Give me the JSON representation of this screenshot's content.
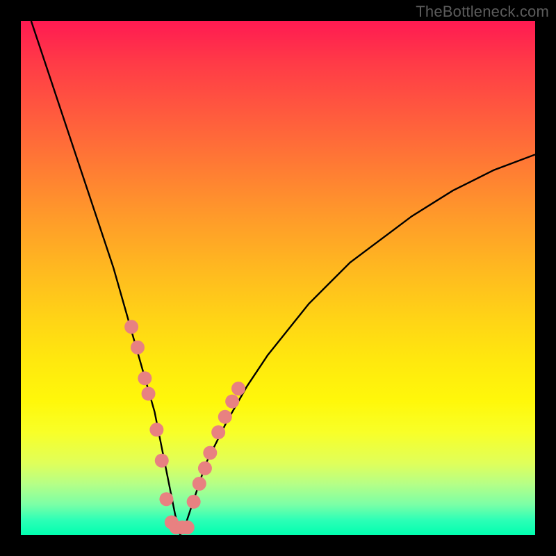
{
  "watermark": "TheBottleneck.com",
  "colors": {
    "frame": "#000000",
    "curve": "#000000",
    "dots": "#e88181",
    "dot_stroke": "#d76a6a"
  },
  "chart_data": {
    "type": "line",
    "title": "",
    "xlabel": "",
    "ylabel": "",
    "xlim": [
      0,
      100
    ],
    "ylim": [
      0,
      100
    ],
    "grid": false,
    "series": [
      {
        "name": "bottleneck-curve",
        "x": [
          2,
          4,
          6,
          8,
          10,
          12,
          14,
          16,
          18,
          20,
          22,
          24,
          26,
          28,
          30,
          31,
          32,
          34,
          36,
          40,
          44,
          48,
          52,
          56,
          60,
          64,
          68,
          72,
          76,
          80,
          84,
          88,
          92,
          96,
          100
        ],
        "y": [
          100,
          94,
          88,
          82,
          76,
          70,
          64,
          58,
          52,
          45,
          38,
          31,
          24,
          14,
          4,
          0,
          2,
          8,
          14,
          22,
          29,
          35,
          40,
          45,
          49,
          53,
          56,
          59,
          62,
          64.5,
          67,
          69,
          71,
          72.5,
          74
        ]
      }
    ],
    "highlight_points": {
      "name": "salmon-dots",
      "x": [
        21.5,
        22.7,
        24.1,
        24.8,
        26.4,
        27.4,
        28.3,
        29.3,
        30.2,
        31.4,
        32.4,
        33.6,
        34.7,
        35.8,
        36.8,
        38.4,
        39.7,
        41.1,
        42.3
      ],
      "y": [
        40.5,
        36.5,
        30.5,
        27.5,
        20.5,
        14.5,
        7.0,
        2.5,
        1.5,
        1.5,
        1.5,
        6.5,
        10.0,
        13.0,
        16.0,
        20.0,
        23.0,
        26.0,
        28.5
      ]
    }
  }
}
